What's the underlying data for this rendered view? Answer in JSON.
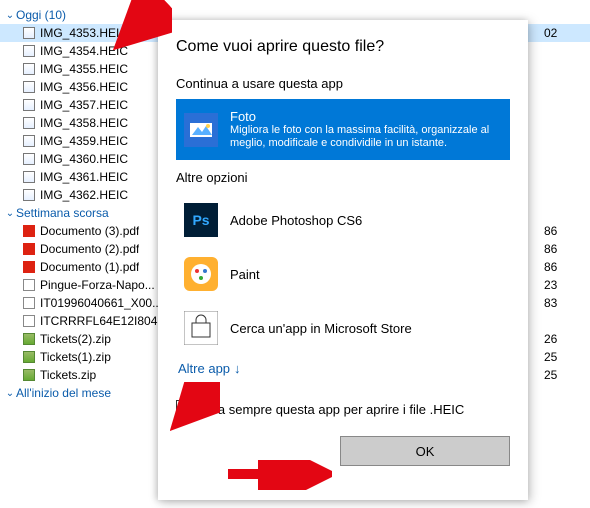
{
  "explorer": {
    "groups": [
      {
        "label": "Oggi (10)",
        "files": [
          {
            "name": "IMG_4353.HEIC",
            "icon": "heic",
            "selected": true,
            "right": "02"
          },
          {
            "name": "IMG_4354.HEIC",
            "icon": "heic"
          },
          {
            "name": "IMG_4355.HEIC",
            "icon": "heic"
          },
          {
            "name": "IMG_4356.HEIC",
            "icon": "heic"
          },
          {
            "name": "IMG_4357.HEIC",
            "icon": "heic"
          },
          {
            "name": "IMG_4358.HEIC",
            "icon": "heic"
          },
          {
            "name": "IMG_4359.HEIC",
            "icon": "heic"
          },
          {
            "name": "IMG_4360.HEIC",
            "icon": "heic"
          },
          {
            "name": "IMG_4361.HEIC",
            "icon": "heic"
          },
          {
            "name": "IMG_4362.HEIC",
            "icon": "heic"
          }
        ]
      },
      {
        "label": "Settimana scorsa",
        "files": [
          {
            "name": "Documento (3).pdf",
            "icon": "pdf",
            "right": "86"
          },
          {
            "name": "Documento (2).pdf",
            "icon": "pdf",
            "right": "86"
          },
          {
            "name": "Documento (1).pdf",
            "icon": "pdf",
            "right": "86"
          },
          {
            "name": "Pingue-Forza-Napo...",
            "icon": "doc",
            "right": "23"
          },
          {
            "name": "IT01996040661_X00...",
            "icon": "doc",
            "right": "83"
          },
          {
            "name": "ITCRRRFL64E12I804...",
            "icon": "doc"
          },
          {
            "name": "Tickets(2).zip",
            "icon": "zip",
            "right": "26"
          },
          {
            "name": "Tickets(1).zip",
            "icon": "zip",
            "right": "25"
          },
          {
            "name": "Tickets.zip",
            "icon": "zip",
            "right": "25"
          }
        ]
      },
      {
        "label": "All'inizio del mese",
        "files": []
      }
    ]
  },
  "dialog": {
    "title": "Come vuoi aprire questo file?",
    "continue_label": "Continua a usare questa app",
    "selected_app": {
      "name": "Foto",
      "desc": "Migliora le foto con la massima facilità, organizzale al meglio, modificale e condividile in un istante."
    },
    "other_label": "Altre opzioni",
    "apps": [
      {
        "name": "Adobe Photoshop CS6",
        "icon": "ps"
      },
      {
        "name": "Paint",
        "icon": "paint"
      },
      {
        "name": "Cerca un'app in Microsoft Store",
        "icon": "store"
      }
    ],
    "more_apps": "Altre app",
    "always_label": "Usa sempre questa app per aprire i file .HEIC",
    "ok_label": "OK"
  }
}
